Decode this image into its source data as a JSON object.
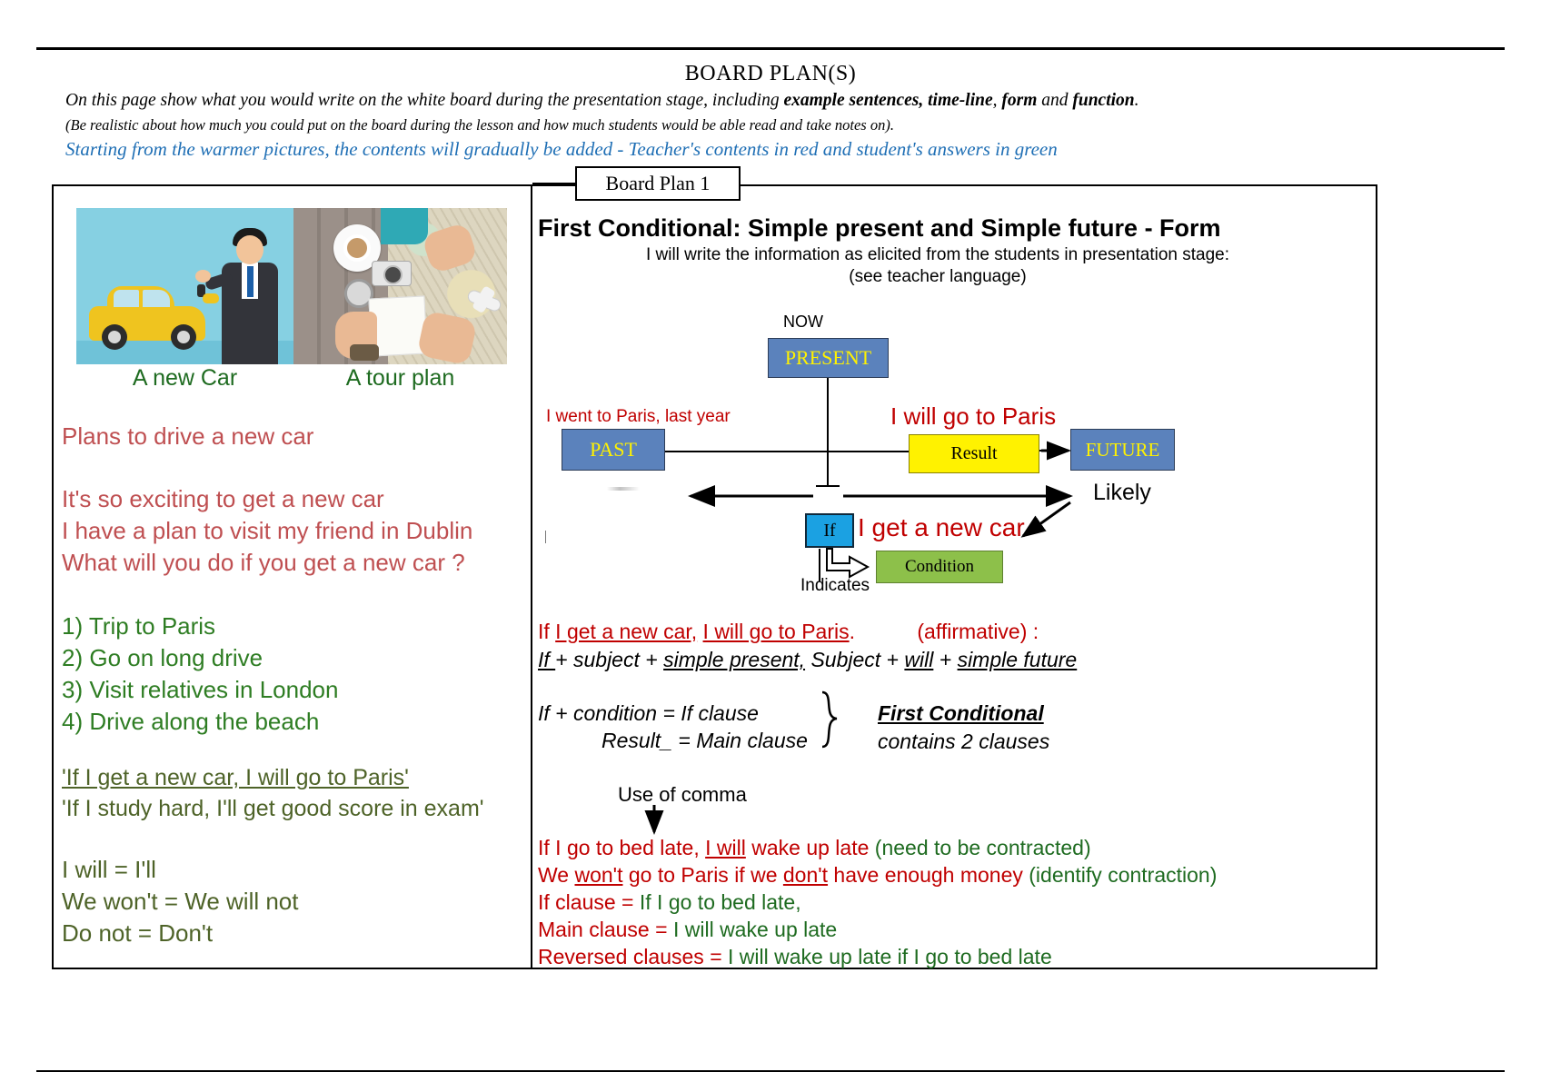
{
  "header": {
    "title": "BOARD PLAN(S)",
    "intro_line1_a": "On this page show what you would write on the white board during the presentation stage, including ",
    "intro_line1_b": "example sentences, time-line",
    "intro_line1_c": ", ",
    "intro_line1_d": "form",
    "intro_line1_e": " and ",
    "intro_line1_f": "function",
    "intro_line1_g": ".",
    "intro_line2": "(Be realistic about how much you could put on the board during the lesson and how much students would be able read and take notes on).",
    "intro_line3": "Starting from the warmer pictures, the contents will gradually be added - Teacher's contents in red and student's answers in green",
    "accent_blue": "#1F6FB5"
  },
  "tab": {
    "label": "Board Plan 1"
  },
  "left": {
    "caption_left": "A new Car",
    "caption_right": "A tour plan",
    "plans_heading": "Plans to drive a new car",
    "teacher_sentences": [
      "It's so exciting to get a new car",
      "I have a plan to visit my friend in Dublin",
      "What will you do if you get a new car ?"
    ],
    "student_answers": [
      "1) Trip to Paris",
      "2) Go on long drive",
      "3) Visit relatives in London",
      "4) Drive along the beach"
    ],
    "quotes": [
      "'If I get a new car, I will go to Paris'",
      "'If I study hard, I'll get good score in exam'"
    ],
    "contractions": [
      "I will = I'll",
      "We won't = We will not",
      "Do not = Don't"
    ],
    "colors": {
      "red": "#BF4F51",
      "green": "#2E7D23",
      "olive": "#4E6328"
    }
  },
  "right": {
    "title": "First Conditional:  Simple present and Simple future - Form",
    "subtitle1": "I will write the information as elicited from the students in presentation stage:",
    "subtitle2": "(see teacher language)",
    "timeline": {
      "now_label": "NOW",
      "present_box": "PRESENT",
      "past_box": "PAST",
      "future_box": "FUTURE",
      "result_box": "Result",
      "if_box": "If",
      "condition_box": "Condition",
      "past_sentence": "I went to Paris, last year",
      "future_sentence": "I will go to Paris",
      "condition_sentence": "I get a new car",
      "likely_label": "Likely",
      "indicates_label": "Indicates",
      "colors": {
        "box_blue": "#5B82BC",
        "box_yellow": "#FFF200",
        "box_if_blue": "#1BA1E2",
        "box_green": "#8DC04A",
        "box_text_yellow": "#FFF200",
        "red_text": "#C00000"
      }
    },
    "form": {
      "example_a": "If ",
      "example_b": "I get a new car,",
      "example_c": "  ",
      "example_d": "I will go to Paris",
      "example_e": ".",
      "example_affirmative": "(affirmative) :",
      "pattern_if": "If ",
      "pattern_mid1": "+ subject + ",
      "pattern_simple_present": "simple present,",
      "pattern_subject": " Subject + ",
      "pattern_will": "will",
      "pattern_plus": " + ",
      "pattern_simple_future": "simple future",
      "clause1": "If + condition  =  If clause",
      "clause2": "Result_ =  Main clause",
      "label_first_conditional": "First Conditional",
      "label_contains": "contains 2 clauses",
      "use_of_comma": "Use of comma"
    },
    "bottom": [
      {
        "red_a": "If I go to bed late, ",
        "red_u": "I will",
        "red_b": " wake up late  ",
        "green": "(need to be contracted)"
      },
      {
        "red_a": "We ",
        "red_u": "won't",
        "red_b": " go to Paris if we ",
        "red_u2": "don't",
        "red_c": " have enough money ",
        "green": "(identify contraction)"
      },
      {
        "red_a": "If clause = ",
        "green": "If I go to bed late,"
      },
      {
        "red_a": "Main clause = ",
        "green": "I will wake up late"
      },
      {
        "red_a": "Reversed clauses  = ",
        "green": "I will wake up late if I go to bed late"
      }
    ]
  },
  "icons": {
    "car_image": "car-salesman-illustration",
    "tour_image": "travel-planning-photo"
  }
}
